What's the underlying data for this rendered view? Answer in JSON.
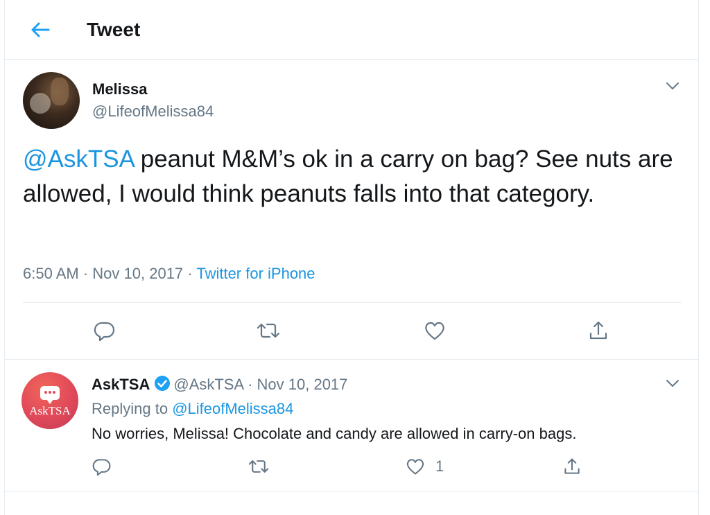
{
  "header": {
    "title": "Tweet",
    "back_icon": "arrow-left-icon",
    "accent": "#1da1f2"
  },
  "main_tweet": {
    "author_name": "Melissa",
    "author_handle": "@LifeofMelissa84",
    "mention": "@AskTSA",
    "text": " peanut M&M’s ok in a carry on bag? See nuts are allowed, I would think peanuts falls into that category.",
    "time": "6:50 AM",
    "date": "Nov 10, 2017",
    "separator": "·",
    "source": "Twitter for iPhone",
    "actions": [
      "reply-icon",
      "retweet-icon",
      "like-icon",
      "share-icon"
    ]
  },
  "reply_tweet": {
    "author_name": "AskTSA",
    "verified": true,
    "author_handle": "@AskTSA",
    "separator": "·",
    "date": "Nov 10, 2017",
    "replying_prefix": "Replying to ",
    "replying_to": "@LifeofMelissa84",
    "text": "No worries, Melissa! Chocolate and candy are allowed in carry-on bags.",
    "like_count": "1",
    "avatar_text": "AskTSA",
    "actions": [
      "reply-icon",
      "retweet-icon",
      "like-icon",
      "share-icon"
    ]
  },
  "colors": {
    "link": "#1b95e0",
    "muted": "#657786",
    "text": "#14171a",
    "border": "#e6ecf0"
  }
}
